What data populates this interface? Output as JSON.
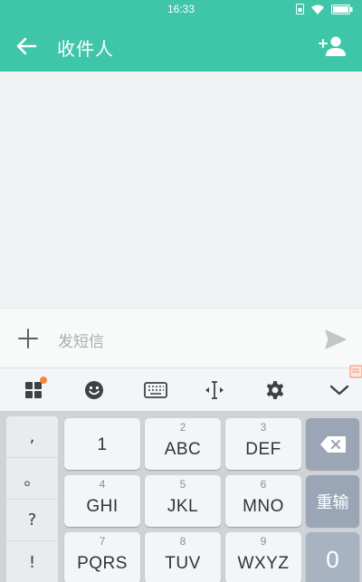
{
  "status_bar": {
    "time": "16:33"
  },
  "app_bar": {
    "title": "收件人"
  },
  "compose": {
    "placeholder": "发短信"
  },
  "keyboard": {
    "punctuation": [
      ",",
      "。",
      "?",
      "!"
    ],
    "keys": [
      {
        "num": "",
        "label": "1"
      },
      {
        "num": "2",
        "label": "ABC"
      },
      {
        "num": "3",
        "label": "DEF"
      },
      {
        "num": "4",
        "label": "GHI"
      },
      {
        "num": "5",
        "label": "JKL"
      },
      {
        "num": "6",
        "label": "MNO"
      },
      {
        "num": "7",
        "label": "PQRS"
      },
      {
        "num": "8",
        "label": "TUV"
      },
      {
        "num": "9",
        "label": "WXYZ"
      }
    ],
    "enter_label": "重输",
    "zero_label": "0"
  },
  "colors": {
    "accent": "#3fc6a8",
    "badge": "#f2863a",
    "side_key": "#9aa6b5"
  }
}
